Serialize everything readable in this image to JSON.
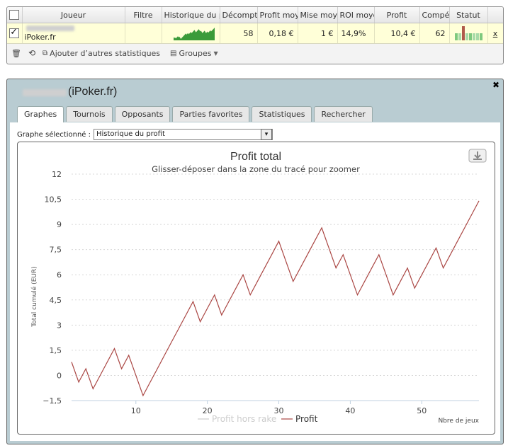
{
  "grid": {
    "columns": [
      "Joueur",
      "Filtre",
      "Historique du profit",
      "Décompte",
      "Profit moyen",
      "Mise moyenne",
      "ROI moyen",
      "Profit",
      "Compétitions",
      "Statut"
    ],
    "row": {
      "site": "iPoker.fr",
      "decompte": "58",
      "profit_moyen": "0,18 €",
      "mise_moyenne": "1 €",
      "roi_moyen": "14,9%",
      "profit": "10,4 €",
      "competitions": "62",
      "remove": "x"
    }
  },
  "toolbar": {
    "add_stats": "Ajouter d’autres statistiques",
    "groups": "Groupes"
  },
  "dialog": {
    "title": "(iPoker.fr)",
    "close": "✖",
    "tabs": [
      "Graphes",
      "Tournois",
      "Opposants",
      "Parties favorites",
      "Statistiques",
      "Rechercher"
    ],
    "active_tab": 0,
    "graph_label": "Graphe sélectionné :",
    "graph_value": "Historique du profit"
  },
  "chart_data": {
    "type": "line",
    "title": "Profit total",
    "subtitle": "Glisser-déposer dans la zone du tracé pour zoomer",
    "xlabel": "Nbre de jeux",
    "ylabel": "Total cumulé (EUR)",
    "ylim": [
      -1.5,
      12
    ],
    "xlim": [
      1,
      58
    ],
    "yticks": [
      -1.5,
      0,
      1.5,
      3,
      4.5,
      6,
      7.5,
      9,
      10.5,
      12
    ],
    "ytick_labels": [
      "−1,5",
      "0",
      "1,5",
      "3",
      "4,5",
      "6",
      "7,5",
      "9",
      "10,5",
      "12"
    ],
    "xticks": [
      10,
      20,
      30,
      40,
      50
    ],
    "grid": true,
    "legend": "bottom-center",
    "series": [
      {
        "name": "Profit hors rake",
        "color": "#cccccc",
        "x": [],
        "values": []
      },
      {
        "name": "Profit",
        "color": "#aa4643",
        "x": [
          1,
          2,
          3,
          4,
          5,
          6,
          7,
          8,
          9,
          10,
          11,
          12,
          13,
          14,
          15,
          16,
          17,
          18,
          19,
          20,
          21,
          22,
          23,
          24,
          25,
          26,
          27,
          28,
          29,
          30,
          31,
          32,
          33,
          34,
          35,
          36,
          37,
          38,
          39,
          40,
          41,
          42,
          43,
          44,
          45,
          46,
          47,
          48,
          49,
          50,
          51,
          52,
          53,
          54,
          55,
          56,
          57,
          58
        ],
        "values": [
          0.8,
          -0.4,
          0.4,
          -0.8,
          0,
          0.8,
          1.6,
          0.4,
          1.2,
          0,
          -1.2,
          -0.4,
          0.4,
          1.2,
          2,
          2.8,
          3.6,
          4.4,
          3.2,
          4,
          4.8,
          3.6,
          4.4,
          5.2,
          6,
          4.8,
          5.6,
          6.4,
          7.2,
          8,
          6.8,
          5.6,
          6.4,
          7.2,
          8,
          8.8,
          7.6,
          6.4,
          7.2,
          6,
          4.8,
          5.6,
          6.4,
          7.2,
          6,
          4.8,
          5.6,
          6.4,
          5.2,
          6,
          6.8,
          7.6,
          6.4,
          7.2,
          8,
          8.8,
          9.6,
          10.4
        ]
      }
    ]
  },
  "colors": {
    "accent_line": "#aa4643",
    "dialog_header": "#b9ccd2",
    "row_highlight": "#ffffd8",
    "sparkline": "#3a9b3a"
  }
}
